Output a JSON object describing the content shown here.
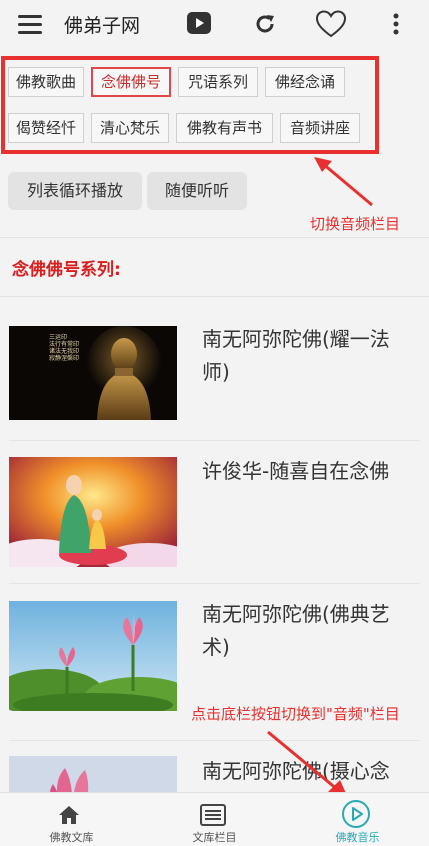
{
  "app": {
    "title": "佛弟子网"
  },
  "header_icons": [
    "menu-icon",
    "play-icon",
    "refresh-icon",
    "heart-icon",
    "more-icon"
  ],
  "categories": [
    {
      "label": "佛教歌曲",
      "active": false
    },
    {
      "label": "念佛佛号",
      "active": true
    },
    {
      "label": "咒语系列",
      "active": false
    },
    {
      "label": "佛经念诵",
      "active": false
    },
    {
      "label": "偈赞经忏",
      "active": false
    },
    {
      "label": "清心梵乐",
      "active": false
    },
    {
      "label": "佛教有声书",
      "active": false
    },
    {
      "label": "音频讲座",
      "active": false
    }
  ],
  "modes": [
    {
      "label": "列表循环播放"
    },
    {
      "label": "随便听听"
    }
  ],
  "annotations": {
    "top": "切换音频栏目",
    "bottom": "点击底栏按钮切换到\"音频\"栏目"
  },
  "section": {
    "title": "念佛佛号系列:"
  },
  "items": [
    {
      "title": "南无阿弥陀佛(耀一法师)",
      "thumb_text": [
        "三运印",
        "法行有常印",
        "诸法无我印",
        "寂静涅槃印"
      ]
    },
    {
      "title": "许俊华-随喜自在念佛"
    },
    {
      "title": "南无阿弥陀佛(佛典艺术)"
    },
    {
      "title": "南无阿弥陀佛(摄心念佛)"
    }
  ],
  "bottom_nav": [
    {
      "label": "佛教文库",
      "icon": "home-icon",
      "active": false
    },
    {
      "label": "文库栏目",
      "icon": "catalog-icon",
      "active": false
    },
    {
      "label": "佛教音乐",
      "icon": "play-circle-icon",
      "active": true
    }
  ],
  "colors": {
    "accent_red": "#e7302f",
    "active_teal": "#2aa9b5",
    "section_red": "#d81e1e"
  }
}
